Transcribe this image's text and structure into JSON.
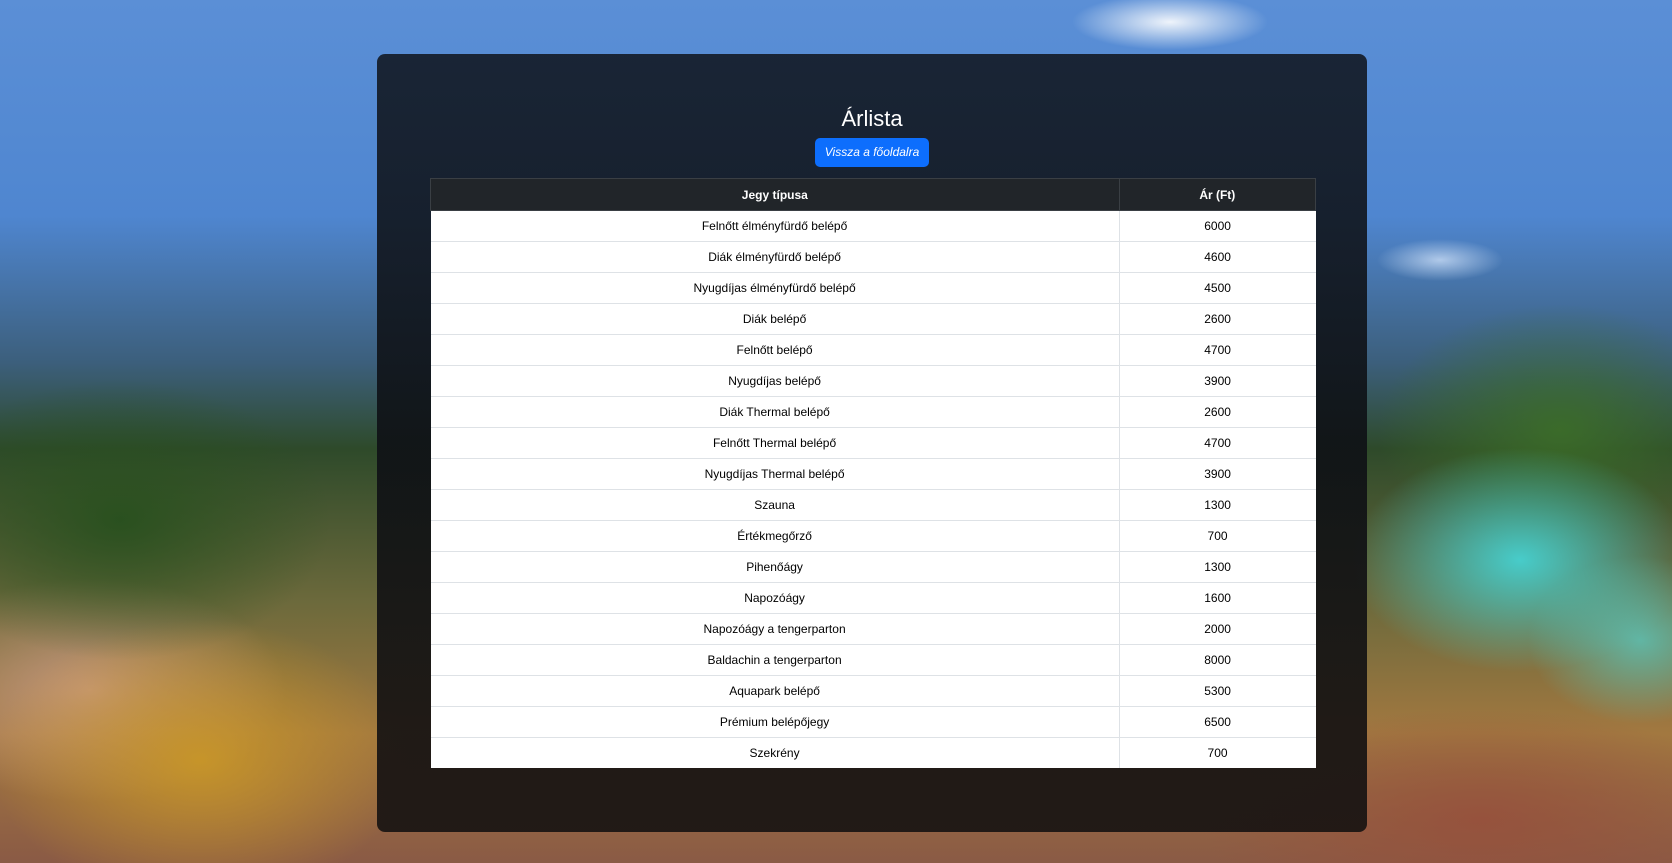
{
  "page": {
    "title": "Árlista",
    "back_button_label": "Vissza a főoldalra"
  },
  "table": {
    "headers": {
      "type": "Jegy típusa",
      "price": "Ár (Ft)"
    },
    "rows": [
      {
        "type": "Felnőtt élményfürdő belépő",
        "price": "6000"
      },
      {
        "type": "Diák élményfürdő belépő",
        "price": "4600"
      },
      {
        "type": "Nyugdíjas élményfürdő belépő",
        "price": "4500"
      },
      {
        "type": "Diák belépő",
        "price": "2600"
      },
      {
        "type": "Felnőtt belépő",
        "price": "4700"
      },
      {
        "type": "Nyugdíjas belépő",
        "price": "3900"
      },
      {
        "type": "Diák Thermal belépő",
        "price": "2600"
      },
      {
        "type": "Felnőtt Thermal belépő",
        "price": "4700"
      },
      {
        "type": "Nyugdíjas Thermal belépő",
        "price": "3900"
      },
      {
        "type": "Szauna",
        "price": "1300"
      },
      {
        "type": "Értékmegőrző",
        "price": "700"
      },
      {
        "type": "Pihenőágy",
        "price": "1300"
      },
      {
        "type": "Napozóágy",
        "price": "1600"
      },
      {
        "type": "Napozóágy a tengerparton",
        "price": "2000"
      },
      {
        "type": "Baldachin a tengerparton",
        "price": "8000"
      },
      {
        "type": "Aquapark belépő",
        "price": "5300"
      },
      {
        "type": "Prémium belépőjegy",
        "price": "6500"
      },
      {
        "type": "Szekrény",
        "price": "700"
      }
    ]
  },
  "colors": {
    "button": "#0d6efd",
    "table_header": "#212529"
  }
}
